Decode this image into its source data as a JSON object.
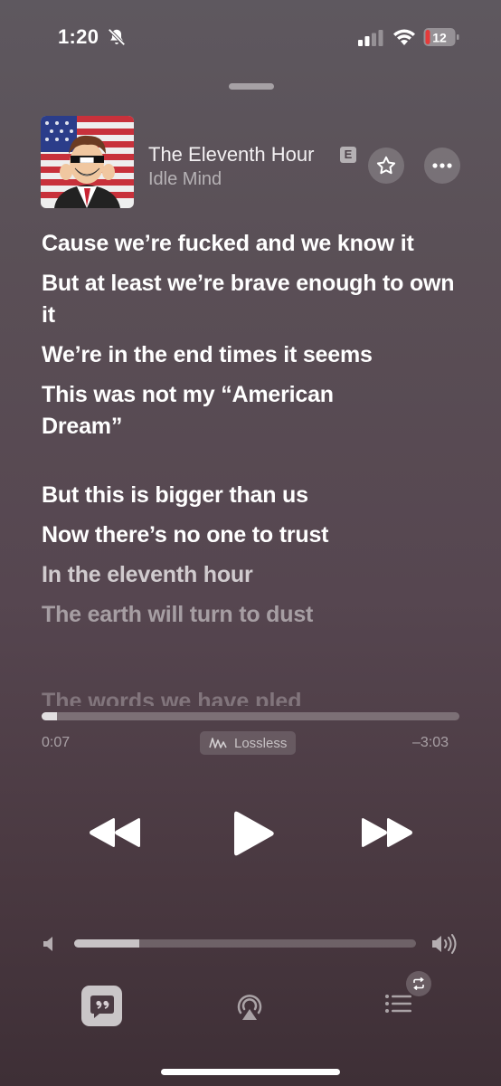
{
  "status_bar": {
    "time": "1:20",
    "battery_level": "12",
    "battery_color": "#e53b3b",
    "icons": [
      "bell-slash-icon",
      "cellular-signal-icon",
      "wifi-icon",
      "battery-icon"
    ]
  },
  "now_playing": {
    "title": "The Eleventh Hour",
    "explicit_badge": "E",
    "artist": "Idle Mind",
    "artwork": "album-artwork"
  },
  "lyrics": [
    "Cause we’re fucked and we know it",
    "But at least we’re brave enough to own it",
    "We’re in the end times it seems",
    "This was not my “American Dream”",
    "But this is bigger than us",
    "Now there’s no one to trust",
    "In the eleventh hour",
    "The earth will turn to dust",
    "The words we have pled"
  ],
  "playback": {
    "elapsed": "0:07",
    "remaining": "–3:03",
    "progress_fraction": 0.037,
    "quality_label": "Lossless"
  },
  "volume": {
    "level_fraction": 0.19
  },
  "toolbar": {
    "lyrics_icon": "quote-bubble-icon",
    "airplay_icon": "airplay-icon",
    "queue_icon": "list-icon",
    "repeat_icon": "repeat-icon"
  }
}
